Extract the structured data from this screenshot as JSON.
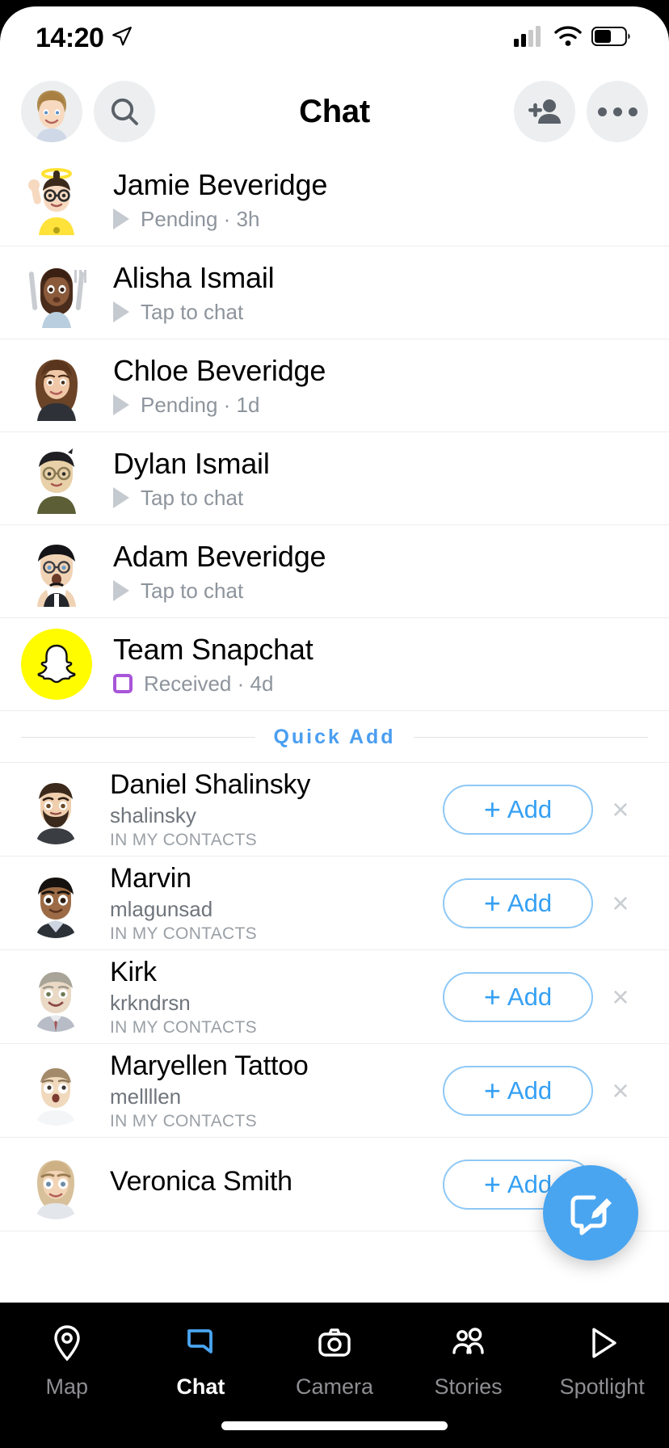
{
  "status_bar": {
    "time": "14:20",
    "location_icon": "location-arrow-icon",
    "cellular_icon": "cellular-signal-icon",
    "wifi_icon": "wifi-icon",
    "battery_icon": "battery-icon"
  },
  "header": {
    "title": "Chat",
    "profile_icon": "bitmoji-avatar",
    "search_icon": "search-icon",
    "add_friend_icon": "add-friend-icon",
    "more_icon": "more-options-icon"
  },
  "chats": [
    {
      "name": "Jamie Beveridge",
      "status": "Pending",
      "time": "3h",
      "status_text": "Pending · 3h",
      "indicator": "sent-arrow"
    },
    {
      "name": "Alisha Ismail",
      "status": "Tap to chat",
      "time": "",
      "status_text": "Tap to chat",
      "indicator": "sent-arrow"
    },
    {
      "name": "Chloe Beveridge",
      "status": "Pending",
      "time": "1d",
      "status_text": "Pending · 1d",
      "indicator": "sent-arrow"
    },
    {
      "name": "Dylan Ismail",
      "status": "Tap to chat",
      "time": "",
      "status_text": "Tap to chat",
      "indicator": "sent-arrow"
    },
    {
      "name": "Adam Beveridge",
      "status": "Tap to chat",
      "time": "",
      "status_text": "Tap to chat",
      "indicator": "sent-arrow"
    },
    {
      "name": "Team Snapchat",
      "status": "Received",
      "time": "4d",
      "status_text": "Received · 4d",
      "indicator": "received-square"
    }
  ],
  "quick_add": {
    "section_label": "Quick Add",
    "add_button_label": "Add",
    "add_button_plus": "+",
    "dismiss_label": "×",
    "contacts_label": "IN MY CONTACTS",
    "items": [
      {
        "name": "Daniel Shalinsky",
        "username": "shalinsky",
        "meta": "IN MY CONTACTS"
      },
      {
        "name": "Marvin",
        "username": "mlagunsad",
        "meta": "IN MY CONTACTS"
      },
      {
        "name": "Kirk",
        "username": "krkndrsn",
        "meta": "IN MY CONTACTS"
      },
      {
        "name": "Maryellen Tattoo",
        "username": "mellllen",
        "meta": "IN MY CONTACTS"
      },
      {
        "name": "Veronica Smith",
        "username": "",
        "meta": ""
      }
    ]
  },
  "fab": {
    "icon": "new-chat-icon"
  },
  "bottom_nav": {
    "active": "Chat",
    "items": [
      {
        "label": "Map",
        "icon": "map-pin-icon"
      },
      {
        "label": "Chat",
        "icon": "chat-bubble-icon"
      },
      {
        "label": "Camera",
        "icon": "camera-icon"
      },
      {
        "label": "Stories",
        "icon": "stories-people-icon"
      },
      {
        "label": "Spotlight",
        "icon": "play-triangle-icon"
      }
    ]
  },
  "colors": {
    "accent_blue": "#4aa5f0",
    "snap_yellow": "#fffc00",
    "purple_received": "#a855d8",
    "nav_inactive": "#8e8e93"
  }
}
